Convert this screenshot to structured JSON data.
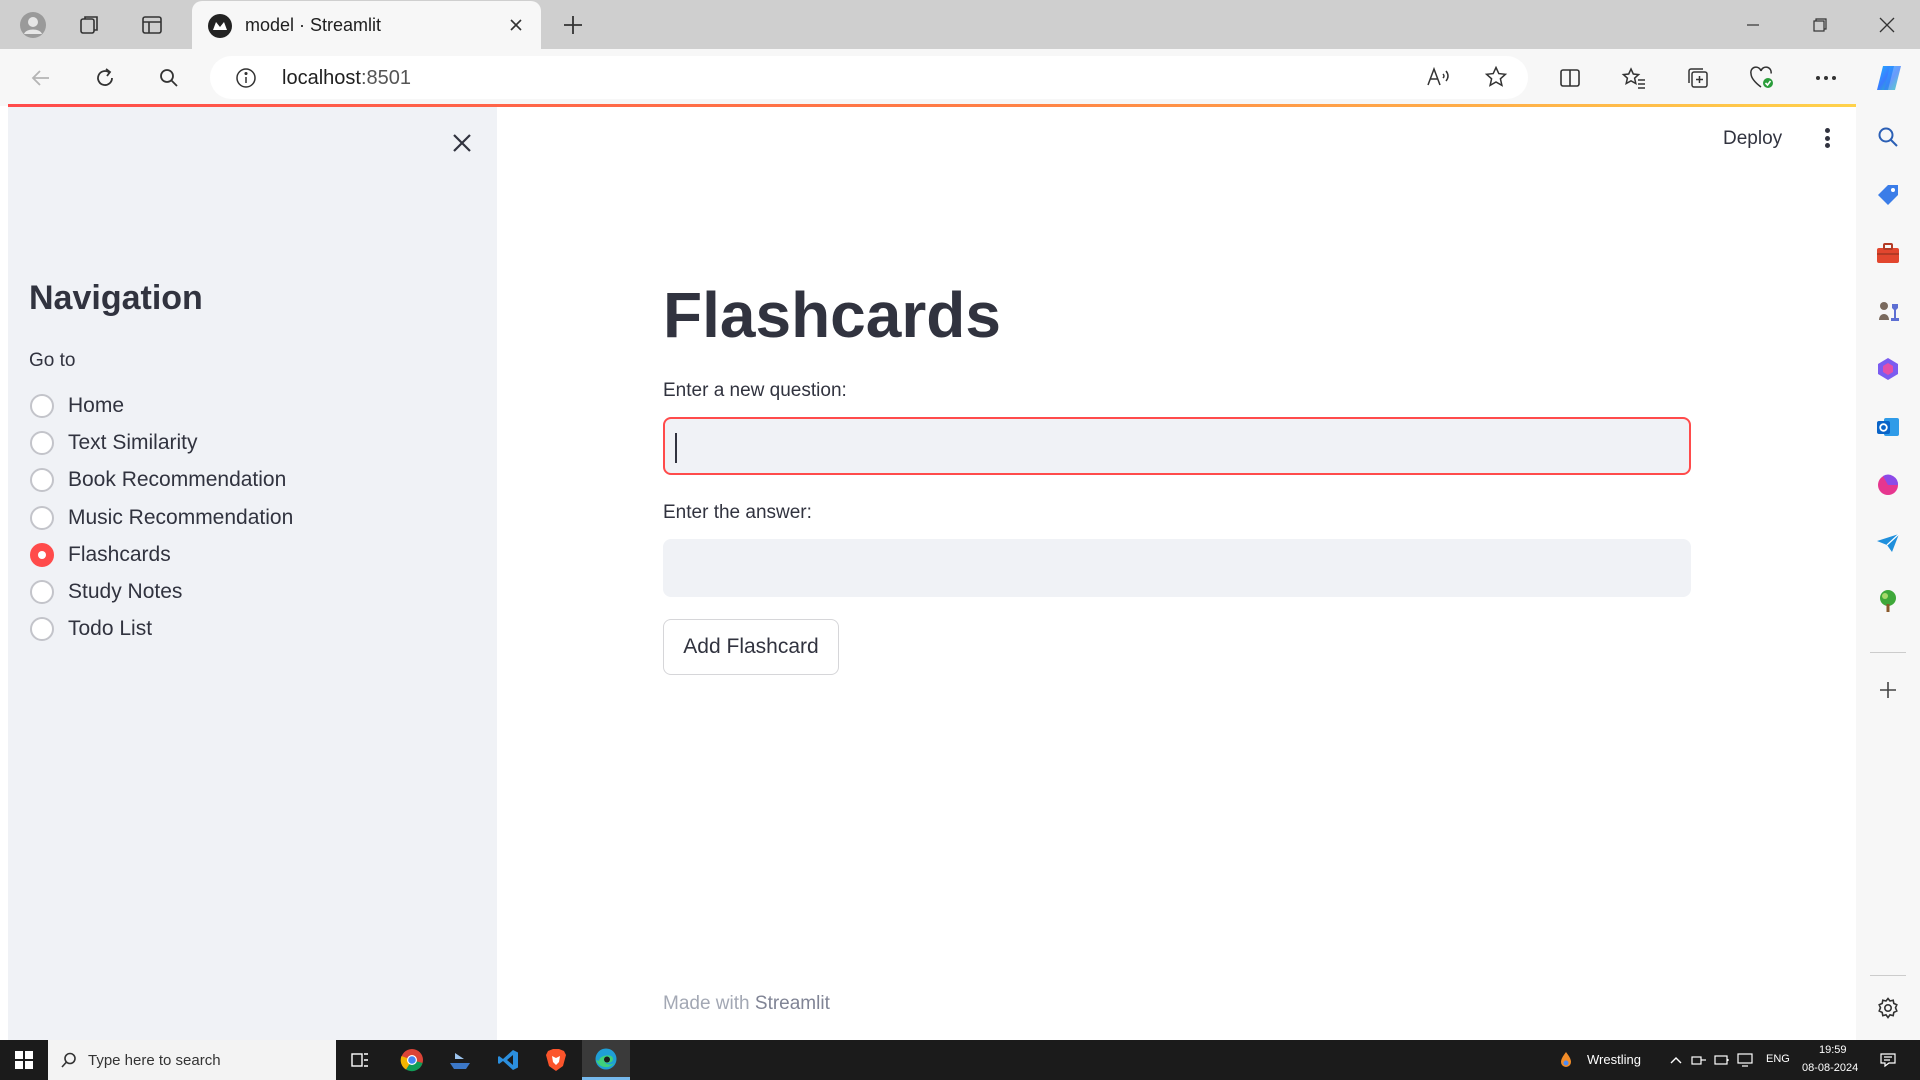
{
  "browser": {
    "tab_title": "model · Streamlit",
    "url_host": "localhost",
    "url_port": ":8501"
  },
  "sidebar": {
    "title": "Navigation",
    "radio_label": "Go to",
    "items": [
      {
        "label": "Home",
        "selected": false
      },
      {
        "label": "Text Similarity",
        "selected": false
      },
      {
        "label": "Book Recommendation",
        "selected": false
      },
      {
        "label": "Music Recommendation",
        "selected": false
      },
      {
        "label": "Flashcards",
        "selected": true
      },
      {
        "label": "Study Notes",
        "selected": false
      },
      {
        "label": "Todo List",
        "selected": false
      }
    ]
  },
  "header": {
    "deploy_label": "Deploy"
  },
  "main": {
    "title": "Flashcards",
    "question_label": "Enter a new question:",
    "question_value": "",
    "answer_label": "Enter the answer:",
    "answer_value": "",
    "add_button_label": "Add Flashcard",
    "footer_prefix": "Made with",
    "footer_brand": "Streamlit"
  },
  "taskbar": {
    "search_placeholder": "Type here to search",
    "weather_text": "Wrestling",
    "language": "ENG",
    "time": "19:59",
    "date": "08-08-2024"
  },
  "colors": {
    "accent": "#ff4b4b",
    "sidebar_bg": "#f0f2f6",
    "text": "#31333f"
  }
}
